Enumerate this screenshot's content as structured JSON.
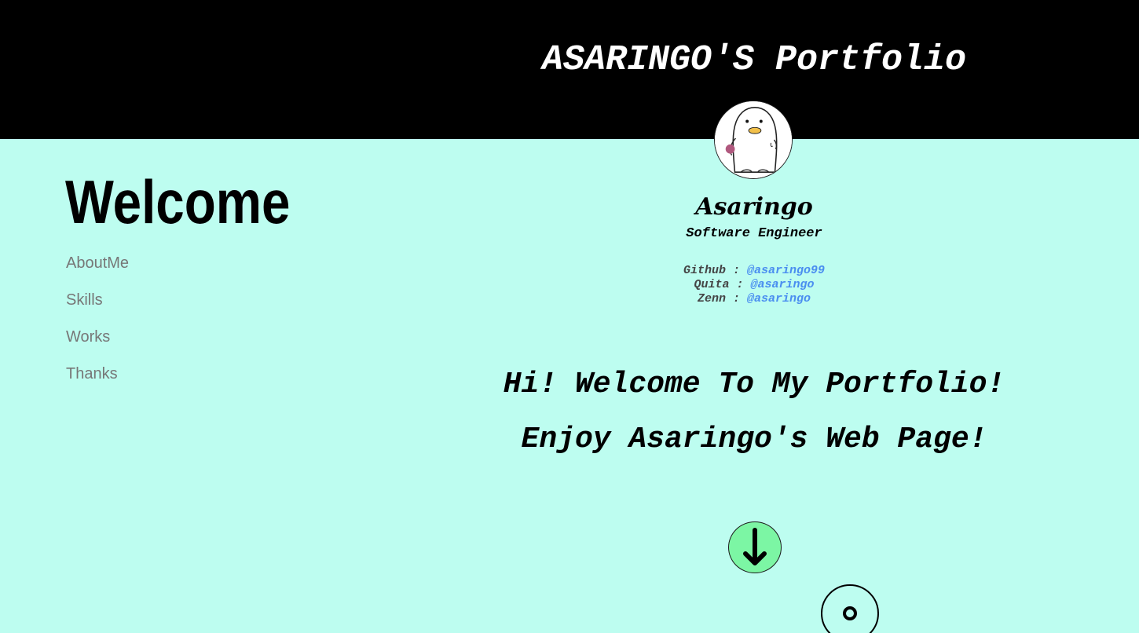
{
  "header": {
    "title": "ASARINGO'S Portfolio"
  },
  "sidebar": {
    "heading": "Welcome",
    "nav_items": [
      {
        "label": "AboutMe"
      },
      {
        "label": "Skills"
      },
      {
        "label": "Works"
      },
      {
        "label": "Thanks"
      }
    ]
  },
  "profile": {
    "avatar_icon": "penguin-avatar-icon",
    "name": "Asaringo",
    "role": "Software Engineer",
    "links": [
      {
        "service": "Github",
        "separator": " : ",
        "handle": "@asaringo99"
      },
      {
        "service": "Quita",
        "separator": " : ",
        "handle": "@asaringo"
      },
      {
        "service": "Zenn",
        "separator": " : ",
        "handle": "@asaringo"
      }
    ]
  },
  "main": {
    "greeting_line_1": "Hi! Welcome To My Portfolio!",
    "greeting_line_2": "Enjoy Asaringo's Web Page!"
  },
  "controls": {
    "scroll_down_icon": "arrow-down-icon",
    "floating_icon": "circle-dot-icon"
  },
  "colors": {
    "background": "#bdfdf0",
    "header": "#000000",
    "link": "#4a8ef0",
    "nav_text": "#777777",
    "scroll_button": "#7cf6a4"
  }
}
